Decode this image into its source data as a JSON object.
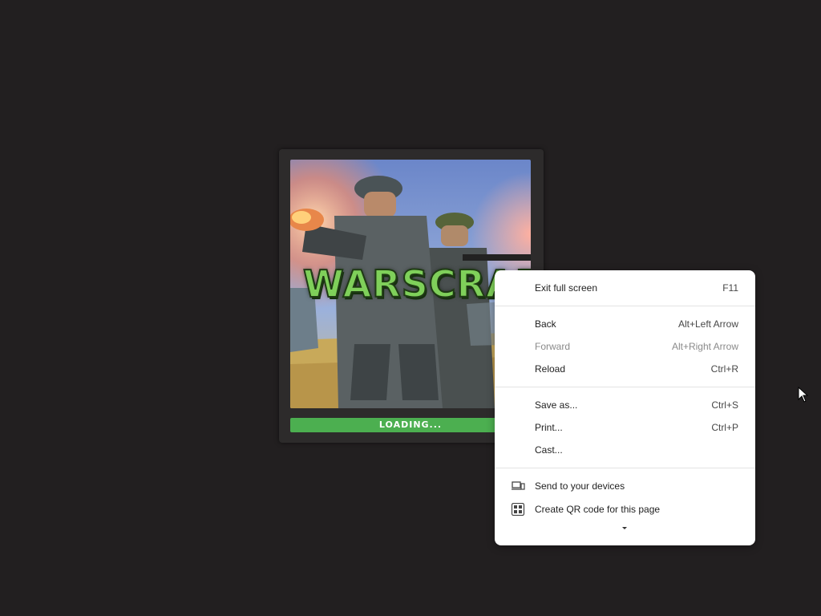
{
  "game": {
    "logo_text": "WARSCRAFT",
    "loading_label": "LOADING...",
    "loading_progress_percent": 85
  },
  "context_menu": {
    "items": [
      {
        "label": "Exit full screen",
        "shortcut": "F11",
        "enabled": true
      },
      {
        "label": "Back",
        "shortcut": "Alt+Left Arrow",
        "enabled": true
      },
      {
        "label": "Forward",
        "shortcut": "Alt+Right Arrow",
        "enabled": false
      },
      {
        "label": "Reload",
        "shortcut": "Ctrl+R",
        "enabled": true
      },
      {
        "label": "Save as...",
        "shortcut": "Ctrl+S",
        "enabled": true
      },
      {
        "label": "Print...",
        "shortcut": "Ctrl+P",
        "enabled": true
      },
      {
        "label": "Cast...",
        "shortcut": "",
        "enabled": true
      },
      {
        "label": "Send to your devices",
        "icon": "devices-icon",
        "enabled": true
      },
      {
        "label": "Create QR code for this page",
        "icon": "qr-code-icon",
        "enabled": true
      }
    ],
    "more_icon": "chevron-down-icon"
  },
  "colors": {
    "background": "#221f20",
    "progress": "#4caf50",
    "menu_bg": "#ffffff"
  }
}
